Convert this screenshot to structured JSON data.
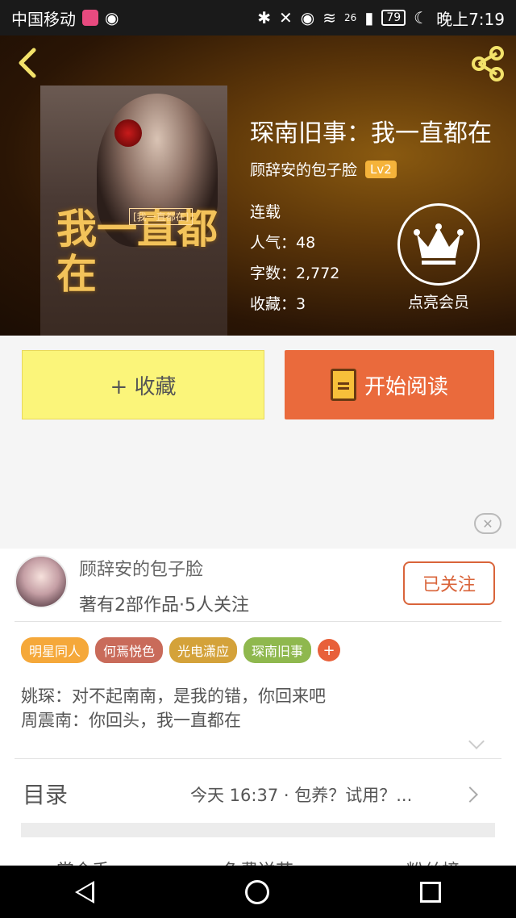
{
  "status_bar": {
    "carrier": "中国移动",
    "network": "26",
    "battery": "79",
    "time": "晚上7:19"
  },
  "book": {
    "title": "琛南旧事：我一直都在",
    "author": "顾辞安的包子脸",
    "author_level": "Lv2",
    "status": "连载",
    "popularity": "人气：48",
    "word_count": "字数：2,772",
    "favorites": "收藏：3",
    "cover_title_art": "我一直都在",
    "cover_subtitle": "[我一直都在]"
  },
  "vip": {
    "label": "点亮会员"
  },
  "actions": {
    "collect_label": "+ 收藏",
    "read_label": "开始阅读",
    "close_symbol": "✕"
  },
  "author_card": {
    "name": "顾辞安的包子脸",
    "info": "著有2部作品·5人关注",
    "follow_label": "已关注",
    "tags": [
      {
        "label": "明星同人",
        "color": "#f5a83a"
      },
      {
        "label": "何焉悦色",
        "color": "#c96b5a"
      },
      {
        "label": "光电潇应",
        "color": "#d4a23a"
      },
      {
        "label": "琛南旧事",
        "color": "#8fb84e"
      }
    ],
    "tag_more": "+",
    "description": [
      "姚琛：对不起南南，是我的错，你回来吧",
      "周震南：你回头，我一直都在"
    ]
  },
  "toc": {
    "label": "目录",
    "latest": "今天 16:37 · 包养？试用？..."
  },
  "bottom_strip": [
    "赏金手",
    "免费送花",
    "粉丝榜"
  ],
  "colors": {
    "accent_orange": "#ea6a3c",
    "collect_yellow": "#fbf57a",
    "badge_gold": "#f5b33a"
  }
}
